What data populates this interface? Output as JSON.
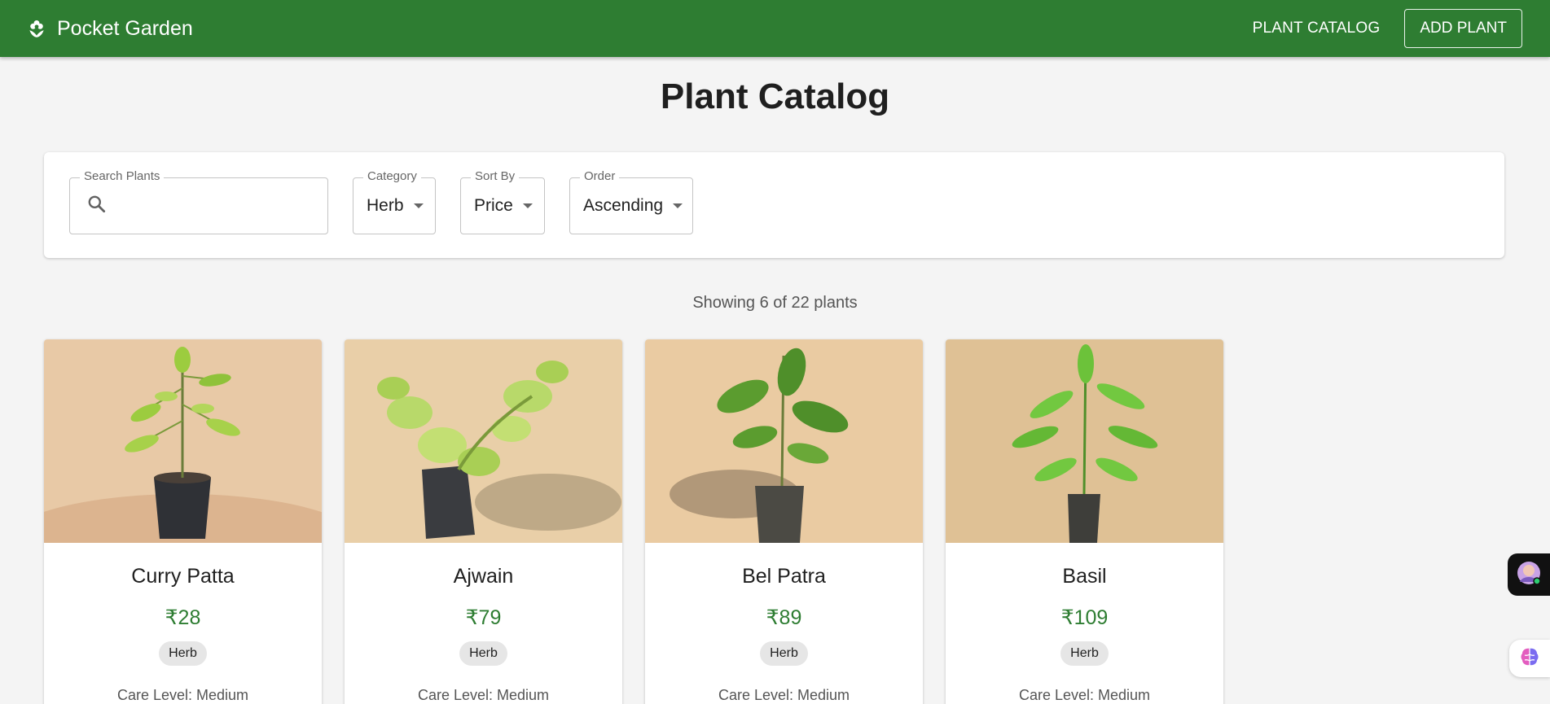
{
  "appbar": {
    "brand": "Pocket Garden",
    "nav_catalog": "PLANT CATALOG",
    "nav_add": "ADD PLANT",
    "color": "#2e7d32"
  },
  "page": {
    "title": "Plant Catalog"
  },
  "filters": {
    "search_label": "Search Plants",
    "search_value": "",
    "category_label": "Category",
    "category_value": "Herb",
    "sort_label": "Sort By",
    "sort_value": "Price",
    "order_label": "Order",
    "order_value": "Ascending"
  },
  "results": {
    "showing": "Showing 6 of 22 plants"
  },
  "plants": [
    {
      "name": "Curry Patta",
      "price": "₹28",
      "category": "Herb",
      "care": "Care Level: Medium"
    },
    {
      "name": "Ajwain",
      "price": "₹79",
      "category": "Herb",
      "care": "Care Level: Medium"
    },
    {
      "name": "Bel Patra",
      "price": "₹89",
      "category": "Herb",
      "care": "Care Level: Medium"
    },
    {
      "name": "Basil",
      "price": "₹109",
      "category": "Herb",
      "care": "Care Level: Medium"
    }
  ],
  "icons": {
    "brand": "flower-icon",
    "search": "search-icon",
    "dropdown": "caret-down-icon",
    "extension": "assistant-avatar-icon",
    "brain": "brain-icon"
  }
}
